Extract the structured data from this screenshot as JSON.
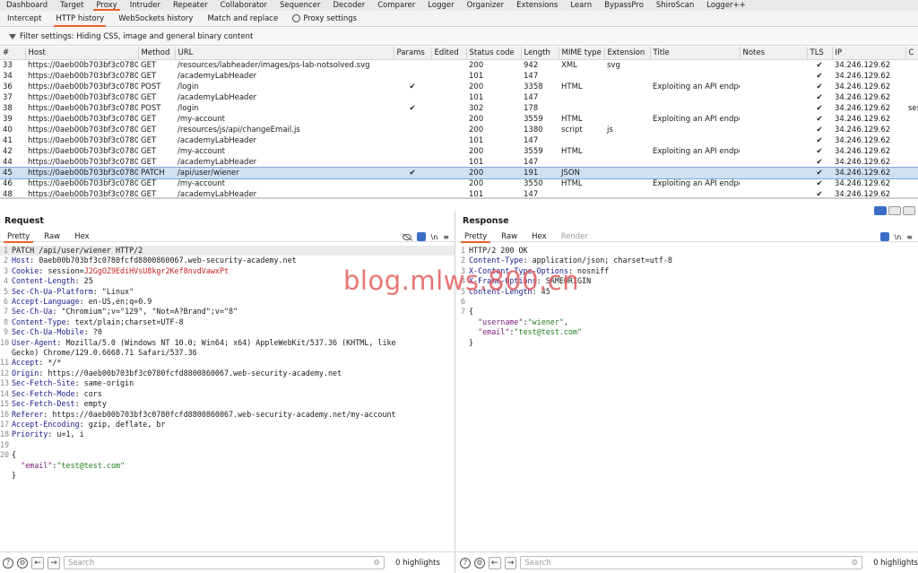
{
  "top_tabs": [
    "Dashboard",
    "Target",
    "Proxy",
    "Intruder",
    "Repeater",
    "Collaborator",
    "Sequencer",
    "Decoder",
    "Comparer",
    "Logger",
    "Organizer",
    "Extensions",
    "Learn",
    "BypassPro",
    "ShiroScan",
    "Logger++"
  ],
  "active_top_tab": "Proxy",
  "sub_tabs": [
    "Intercept",
    "HTTP history",
    "WebSockets history",
    "Match and replace",
    "Proxy settings"
  ],
  "active_sub_tab": "HTTP history",
  "filter_text": "Filter settings: Hiding CSS, image and general binary content",
  "columns": [
    "#",
    "Host",
    "Method",
    "URL",
    "Params",
    "Edited",
    "Status code",
    "Length",
    "MIME type",
    "Extension",
    "Title",
    "Notes",
    "TLS",
    "IP",
    "C"
  ],
  "rows": [
    {
      "num": "33",
      "host": "https://0aeb00b703bf3c0780...",
      "method": "GET",
      "url": "/resources/labheader/images/ps-lab-notsolved.svg",
      "params": "",
      "edited": "",
      "status": "200",
      "length": "942",
      "mime": "XML",
      "ext": "svg",
      "title": "",
      "notes": "",
      "tls": "✔",
      "ip": "34.246.129.62",
      "cookies": ""
    },
    {
      "num": "34",
      "host": "https://0aeb00b703bf3c0780...",
      "method": "GET",
      "url": "/academyLabHeader",
      "params": "",
      "edited": "",
      "status": "101",
      "length": "147",
      "mime": "",
      "ext": "",
      "title": "",
      "notes": "",
      "tls": "✔",
      "ip": "34.246.129.62",
      "cookies": ""
    },
    {
      "num": "36",
      "host": "https://0aeb00b703bf3c0780...",
      "method": "POST",
      "url": "/login",
      "params": "✔",
      "edited": "",
      "status": "200",
      "length": "3358",
      "mime": "HTML",
      "ext": "",
      "title": "Exploiting an API endpo...",
      "notes": "",
      "tls": "✔",
      "ip": "34.246.129.62",
      "cookies": ""
    },
    {
      "num": "37",
      "host": "https://0aeb00b703bf3c0780...",
      "method": "GET",
      "url": "/academyLabHeader",
      "params": "",
      "edited": "",
      "status": "101",
      "length": "147",
      "mime": "",
      "ext": "",
      "title": "",
      "notes": "",
      "tls": "✔",
      "ip": "34.246.129.62",
      "cookies": ""
    },
    {
      "num": "38",
      "host": "https://0aeb00b703bf3c0780...",
      "method": "POST",
      "url": "/login",
      "params": "✔",
      "edited": "",
      "status": "302",
      "length": "178",
      "mime": "",
      "ext": "",
      "title": "",
      "notes": "",
      "tls": "✔",
      "ip": "34.246.129.62",
      "cookies": "ses"
    },
    {
      "num": "39",
      "host": "https://0aeb00b703bf3c0780...",
      "method": "GET",
      "url": "/my-account",
      "params": "",
      "edited": "",
      "status": "200",
      "length": "3559",
      "mime": "HTML",
      "ext": "",
      "title": "Exploiting an API endpo...",
      "notes": "",
      "tls": "✔",
      "ip": "34.246.129.62",
      "cookies": ""
    },
    {
      "num": "40",
      "host": "https://0aeb00b703bf3c0780...",
      "method": "GET",
      "url": "/resources/js/api/changeEmail.js",
      "params": "",
      "edited": "",
      "status": "200",
      "length": "1380",
      "mime": "script",
      "ext": "js",
      "title": "",
      "notes": "",
      "tls": "✔",
      "ip": "34.246.129.62",
      "cookies": ""
    },
    {
      "num": "41",
      "host": "https://0aeb00b703bf3c0780...",
      "method": "GET",
      "url": "/academyLabHeader",
      "params": "",
      "edited": "",
      "status": "101",
      "length": "147",
      "mime": "",
      "ext": "",
      "title": "",
      "notes": "",
      "tls": "✔",
      "ip": "34.246.129.62",
      "cookies": ""
    },
    {
      "num": "42",
      "host": "https://0aeb00b703bf3c0780...",
      "method": "GET",
      "url": "/my-account",
      "params": "",
      "edited": "",
      "status": "200",
      "length": "3559",
      "mime": "HTML",
      "ext": "",
      "title": "Exploiting an API endpo...",
      "notes": "",
      "tls": "✔",
      "ip": "34.246.129.62",
      "cookies": ""
    },
    {
      "num": "44",
      "host": "https://0aeb00b703bf3c0780...",
      "method": "GET",
      "url": "/academyLabHeader",
      "params": "",
      "edited": "",
      "status": "101",
      "length": "147",
      "mime": "",
      "ext": "",
      "title": "",
      "notes": "",
      "tls": "✔",
      "ip": "34.246.129.62",
      "cookies": ""
    },
    {
      "num": "45",
      "host": "https://0aeb00b703bf3c0780...",
      "method": "PATCH",
      "url": "/api/user/wiener",
      "params": "✔",
      "edited": "",
      "status": "200",
      "length": "191",
      "mime": "JSON",
      "ext": "",
      "title": "",
      "notes": "",
      "tls": "✔",
      "ip": "34.246.129.62",
      "cookies": "",
      "selected": true
    },
    {
      "num": "46",
      "host": "https://0aeb00b703bf3c0780...",
      "method": "GET",
      "url": "/my-account",
      "params": "",
      "edited": "",
      "status": "200",
      "length": "3550",
      "mime": "HTML",
      "ext": "",
      "title": "Exploiting an API endpo...",
      "notes": "",
      "tls": "✔",
      "ip": "34.246.129.62",
      "cookies": ""
    },
    {
      "num": "48",
      "host": "https://0aeb00b703bf3c0780...",
      "method": "GET",
      "url": "/academyLabHeader",
      "params": "",
      "edited": "",
      "status": "101",
      "length": "147",
      "mime": "",
      "ext": "",
      "title": "",
      "notes": "",
      "tls": "✔",
      "ip": "34.246.129.62",
      "cookies": ""
    }
  ],
  "request": {
    "title": "Request",
    "tabs": [
      "Pretty",
      "Raw",
      "Hex"
    ],
    "active_tab": "Pretty",
    "lines": [
      {
        "n": "1",
        "parts": [
          {
            "t": "PATCH /api/user/wiener HTTP/2",
            "c": ""
          }
        ]
      },
      {
        "n": "2",
        "parts": [
          {
            "t": "Host",
            "c": "k"
          },
          {
            "t": ": 0aeb00b703bf3c0780fcfd8800860067.web-security-academy.net",
            "c": ""
          }
        ]
      },
      {
        "n": "3",
        "parts": [
          {
            "t": "Cookie",
            "c": "k"
          },
          {
            "t": ": session=",
            "c": ""
          },
          {
            "t": "J2GgOZ9EdiHVsU8kgr2Kef8nvdVawxPt",
            "c": "v-red"
          }
        ]
      },
      {
        "n": "4",
        "parts": [
          {
            "t": "Content-Length",
            "c": "k"
          },
          {
            "t": ": 25",
            "c": ""
          }
        ]
      },
      {
        "n": "5",
        "parts": [
          {
            "t": "Sec-Ch-Ua-Platform",
            "c": "k"
          },
          {
            "t": ": \"Linux\"",
            "c": ""
          }
        ]
      },
      {
        "n": "6",
        "parts": [
          {
            "t": "Accept-Language",
            "c": "k"
          },
          {
            "t": ": en-US,en;q=0.9",
            "c": ""
          }
        ]
      },
      {
        "n": "7",
        "parts": [
          {
            "t": "Sec-Ch-Ua",
            "c": "k"
          },
          {
            "t": ": \"Chromium\";v=\"129\", \"Not=A?Brand\";v=\"8\"",
            "c": ""
          }
        ]
      },
      {
        "n": "8",
        "parts": [
          {
            "t": "Content-Type",
            "c": "k"
          },
          {
            "t": ": text/plain;charset=UTF-8",
            "c": ""
          }
        ]
      },
      {
        "n": "9",
        "parts": [
          {
            "t": "Sec-Ch-Ua-Mobile",
            "c": "k"
          },
          {
            "t": ": ?0",
            "c": ""
          }
        ]
      },
      {
        "n": "10",
        "parts": [
          {
            "t": "User-Agent",
            "c": "k"
          },
          {
            "t": ": Mozilla/5.0 (Windows NT 10.0; Win64; x64) AppleWebKit/537.36 (KHTML, like",
            "c": ""
          }
        ]
      },
      {
        "n": "",
        "parts": [
          {
            "t": "Gecko) Chrome/129.0.6668.71 Safari/537.36",
            "c": ""
          }
        ]
      },
      {
        "n": "11",
        "parts": [
          {
            "t": "Accept",
            "c": "k"
          },
          {
            "t": ": */*",
            "c": ""
          }
        ]
      },
      {
        "n": "12",
        "parts": [
          {
            "t": "Origin",
            "c": "k"
          },
          {
            "t": ": https://0aeb00b703bf3c0780fcfd8800860067.web-security-academy.net",
            "c": ""
          }
        ]
      },
      {
        "n": "13",
        "parts": [
          {
            "t": "Sec-Fetch-Site",
            "c": "k"
          },
          {
            "t": ": same-origin",
            "c": ""
          }
        ]
      },
      {
        "n": "14",
        "parts": [
          {
            "t": "Sec-Fetch-Mode",
            "c": "k"
          },
          {
            "t": ": cors",
            "c": ""
          }
        ]
      },
      {
        "n": "15",
        "parts": [
          {
            "t": "Sec-Fetch-Dest",
            "c": "k"
          },
          {
            "t": ": empty",
            "c": ""
          }
        ]
      },
      {
        "n": "16",
        "parts": [
          {
            "t": "Referer",
            "c": "k"
          },
          {
            "t": ": https://0aeb00b703bf3c0780fcfd8800860067.web-security-academy.net/my-account",
            "c": ""
          }
        ]
      },
      {
        "n": "17",
        "parts": [
          {
            "t": "Accept-Encoding",
            "c": "k"
          },
          {
            "t": ": gzip, deflate, br",
            "c": ""
          }
        ]
      },
      {
        "n": "18",
        "parts": [
          {
            "t": "Priority",
            "c": "k"
          },
          {
            "t": ": u=1, i",
            "c": ""
          }
        ]
      },
      {
        "n": "19",
        "parts": [
          {
            "t": "",
            "c": ""
          }
        ]
      },
      {
        "n": "20",
        "parts": [
          {
            "t": "{",
            "c": ""
          }
        ]
      },
      {
        "n": "",
        "parts": [
          {
            "t": "  ",
            "c": ""
          },
          {
            "t": "\"email\"",
            "c": "jkey"
          },
          {
            "t": ":",
            "c": ""
          },
          {
            "t": "\"test@test.com\"",
            "c": "v-green"
          }
        ]
      },
      {
        "n": "",
        "parts": [
          {
            "t": "}",
            "c": ""
          }
        ]
      }
    ],
    "search_placeholder": "Search",
    "highlights": "0 highlights"
  },
  "response": {
    "title": "Response",
    "tabs": [
      "Pretty",
      "Raw",
      "Hex",
      "Render"
    ],
    "active_tab": "Pretty",
    "lines": [
      {
        "n": "1",
        "parts": [
          {
            "t": "HTTP/2 200 OK",
            "c": ""
          }
        ]
      },
      {
        "n": "2",
        "parts": [
          {
            "t": "Content-Type",
            "c": "k"
          },
          {
            "t": ": application/json; charset=utf-8",
            "c": ""
          }
        ]
      },
      {
        "n": "3",
        "parts": [
          {
            "t": "X-Content-Type-Options",
            "c": "k"
          },
          {
            "t": ": nosniff",
            "c": ""
          }
        ]
      },
      {
        "n": "4",
        "parts": [
          {
            "t": "X-Frame-Options",
            "c": "k"
          },
          {
            "t": ": SAMEORIGIN",
            "c": ""
          }
        ]
      },
      {
        "n": "5",
        "parts": [
          {
            "t": "Content-Length",
            "c": "k"
          },
          {
            "t": ": 45",
            "c": ""
          }
        ]
      },
      {
        "n": "6",
        "parts": [
          {
            "t": "",
            "c": ""
          }
        ]
      },
      {
        "n": "7",
        "parts": [
          {
            "t": "{",
            "c": ""
          }
        ]
      },
      {
        "n": "",
        "parts": [
          {
            "t": "  ",
            "c": ""
          },
          {
            "t": "\"username\"",
            "c": "jkey"
          },
          {
            "t": ":",
            "c": ""
          },
          {
            "t": "\"wiener\"",
            "c": "v-green"
          },
          {
            "t": ",",
            "c": ""
          }
        ]
      },
      {
        "n": "",
        "parts": [
          {
            "t": "  ",
            "c": ""
          },
          {
            "t": "\"email\"",
            "c": "jkey"
          },
          {
            "t": ":",
            "c": ""
          },
          {
            "t": "\"test@test.com\"",
            "c": "v-green"
          }
        ]
      },
      {
        "n": "",
        "parts": [
          {
            "t": "}",
            "c": ""
          }
        ]
      }
    ],
    "search_placeholder": "Search",
    "highlights": "0 highlights"
  },
  "watermark": "blog.mlws.800.cn",
  "colors": {
    "accent": "#e8642b",
    "selected_row": "#cfe0f3",
    "header_key": "#1a1a8c",
    "cookie_value": "#c81e1e",
    "json_string": "#1d7a1d"
  }
}
